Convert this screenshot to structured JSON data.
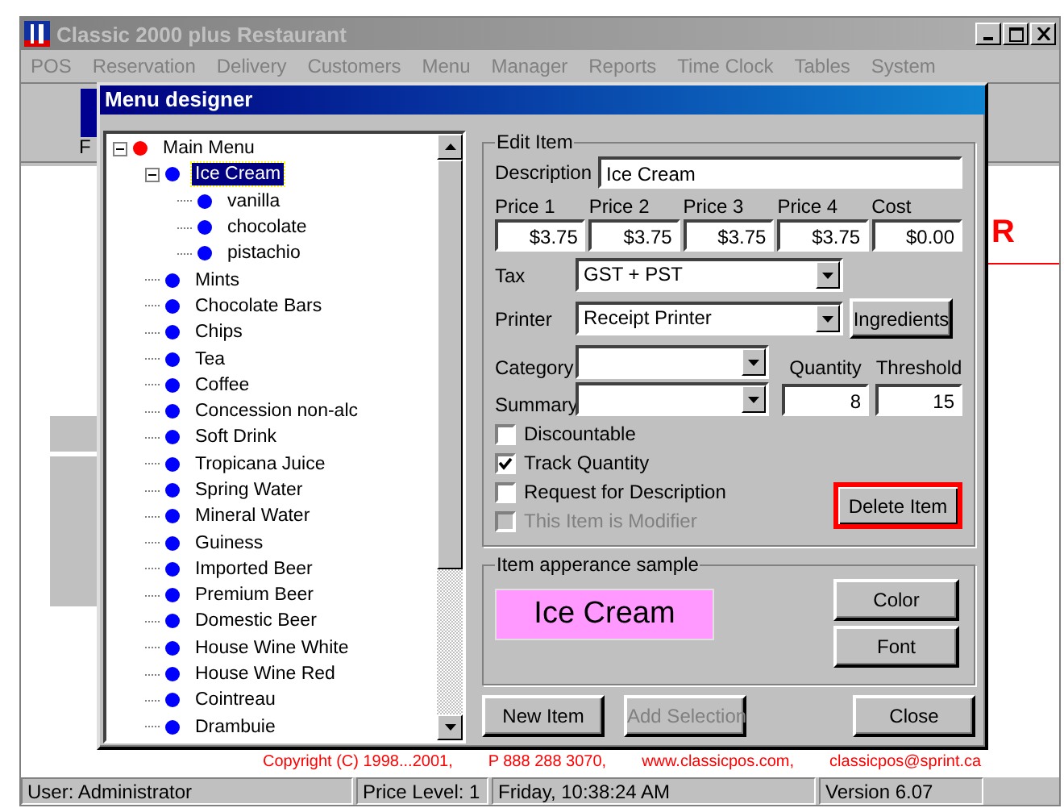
{
  "main_window": {
    "title": "Classic 2000 plus Restaurant",
    "active": false,
    "menu": [
      "POS",
      "Reservation",
      "Delivery",
      "Customers",
      "Menu",
      "Manager",
      "Reports",
      "Time Clock",
      "Tables",
      "System"
    ],
    "toolbar_label": "F",
    "background_heading": "R",
    "copyright": [
      "Copyright (C) 1998...2001,",
      "P 888 288 3070,",
      "www.classicpos.com,",
      "classicpos@sprint.ca"
    ]
  },
  "dialog": {
    "title": "Menu designer",
    "tree": [
      {
        "label": "Main Menu",
        "color": "#ff0000",
        "expanded": true,
        "selected": false,
        "children": [
          {
            "label": "Ice Cream",
            "color": "#0000ff",
            "expanded": true,
            "selected": true,
            "children": [
              {
                "label": "vanilla",
                "color": "#0000ff",
                "selected": false
              },
              {
                "label": "chocolate",
                "color": "#0000ff",
                "selected": false
              },
              {
                "label": "pistachio",
                "color": "#0000ff",
                "selected": false
              }
            ]
          },
          {
            "label": "Mints",
            "color": "#0000ff",
            "selected": false
          },
          {
            "label": "Chocolate Bars",
            "color": "#0000ff",
            "selected": false
          },
          {
            "label": "Chips",
            "color": "#0000ff",
            "selected": false
          },
          {
            "label": "Tea",
            "color": "#0000ff",
            "selected": false
          },
          {
            "label": "Coffee",
            "color": "#0000ff",
            "selected": false
          },
          {
            "label": "Concession non-alc",
            "color": "#0000ff",
            "selected": false
          },
          {
            "label": "Soft Drink",
            "color": "#0000ff",
            "selected": false
          },
          {
            "label": "Tropicana Juice",
            "color": "#0000ff",
            "selected": false
          },
          {
            "label": "Spring Water",
            "color": "#0000ff",
            "selected": false
          },
          {
            "label": "Mineral Water",
            "color": "#0000ff",
            "selected": false
          },
          {
            "label": "Guiness",
            "color": "#0000ff",
            "selected": false
          },
          {
            "label": "Imported Beer",
            "color": "#0000ff",
            "selected": false
          },
          {
            "label": "Premium Beer",
            "color": "#0000ff",
            "selected": false
          },
          {
            "label": "Domestic Beer",
            "color": "#0000ff",
            "selected": false
          },
          {
            "label": "House Wine White",
            "color": "#0000ff",
            "selected": false
          },
          {
            "label": "House Wine Red",
            "color": "#0000ff",
            "selected": false
          },
          {
            "label": "Cointreau",
            "color": "#0000ff",
            "selected": false
          },
          {
            "label": "Drambuie",
            "color": "#0000ff",
            "selected": false
          }
        ]
      }
    ],
    "edit_item": {
      "legend": "Edit Item",
      "description_label": "Description",
      "description": "Ice Cream",
      "prices": [
        {
          "label": "Price 1",
          "value": "$3.75"
        },
        {
          "label": "Price 2",
          "value": "$3.75"
        },
        {
          "label": "Price 3",
          "value": "$3.75"
        },
        {
          "label": "Price 4",
          "value": "$3.75"
        },
        {
          "label": "Cost",
          "value": "$0.00"
        }
      ],
      "tax_label": "Tax",
      "tax": "GST + PST",
      "printer_label": "Printer",
      "printer": "Receipt Printer",
      "ingredients_button": "Ingredients",
      "category_label": "Category",
      "summary_label": "Summary",
      "quantity_label": "Quantity",
      "quantity": "8",
      "threshold_label": "Threshold",
      "threshold": "15",
      "checkboxes": [
        {
          "label": "Discountable",
          "checked": false,
          "disabled": false
        },
        {
          "label": "Track Quantity",
          "checked": true,
          "disabled": false
        },
        {
          "label": "Request for Description",
          "checked": false,
          "disabled": false
        },
        {
          "label": "This Item is Modifier",
          "checked": false,
          "disabled": true
        }
      ],
      "delete_button": {
        "label": "Delete Item",
        "highlighted": true
      }
    },
    "sample": {
      "legend": "Item apperance sample",
      "text": "Ice Cream",
      "color": "#ff99ff",
      "buttons": [
        "Color",
        "Font"
      ]
    },
    "buttons": [
      {
        "label": "New Item",
        "disabled": false
      },
      {
        "label": "Add Selection",
        "disabled": true
      },
      {
        "label": "Close",
        "disabled": false
      }
    ]
  },
  "status_bar": [
    "User: Administrator",
    "Price Level: 1",
    "Friday,  10:38:24 AM",
    "Version 6.07"
  ]
}
